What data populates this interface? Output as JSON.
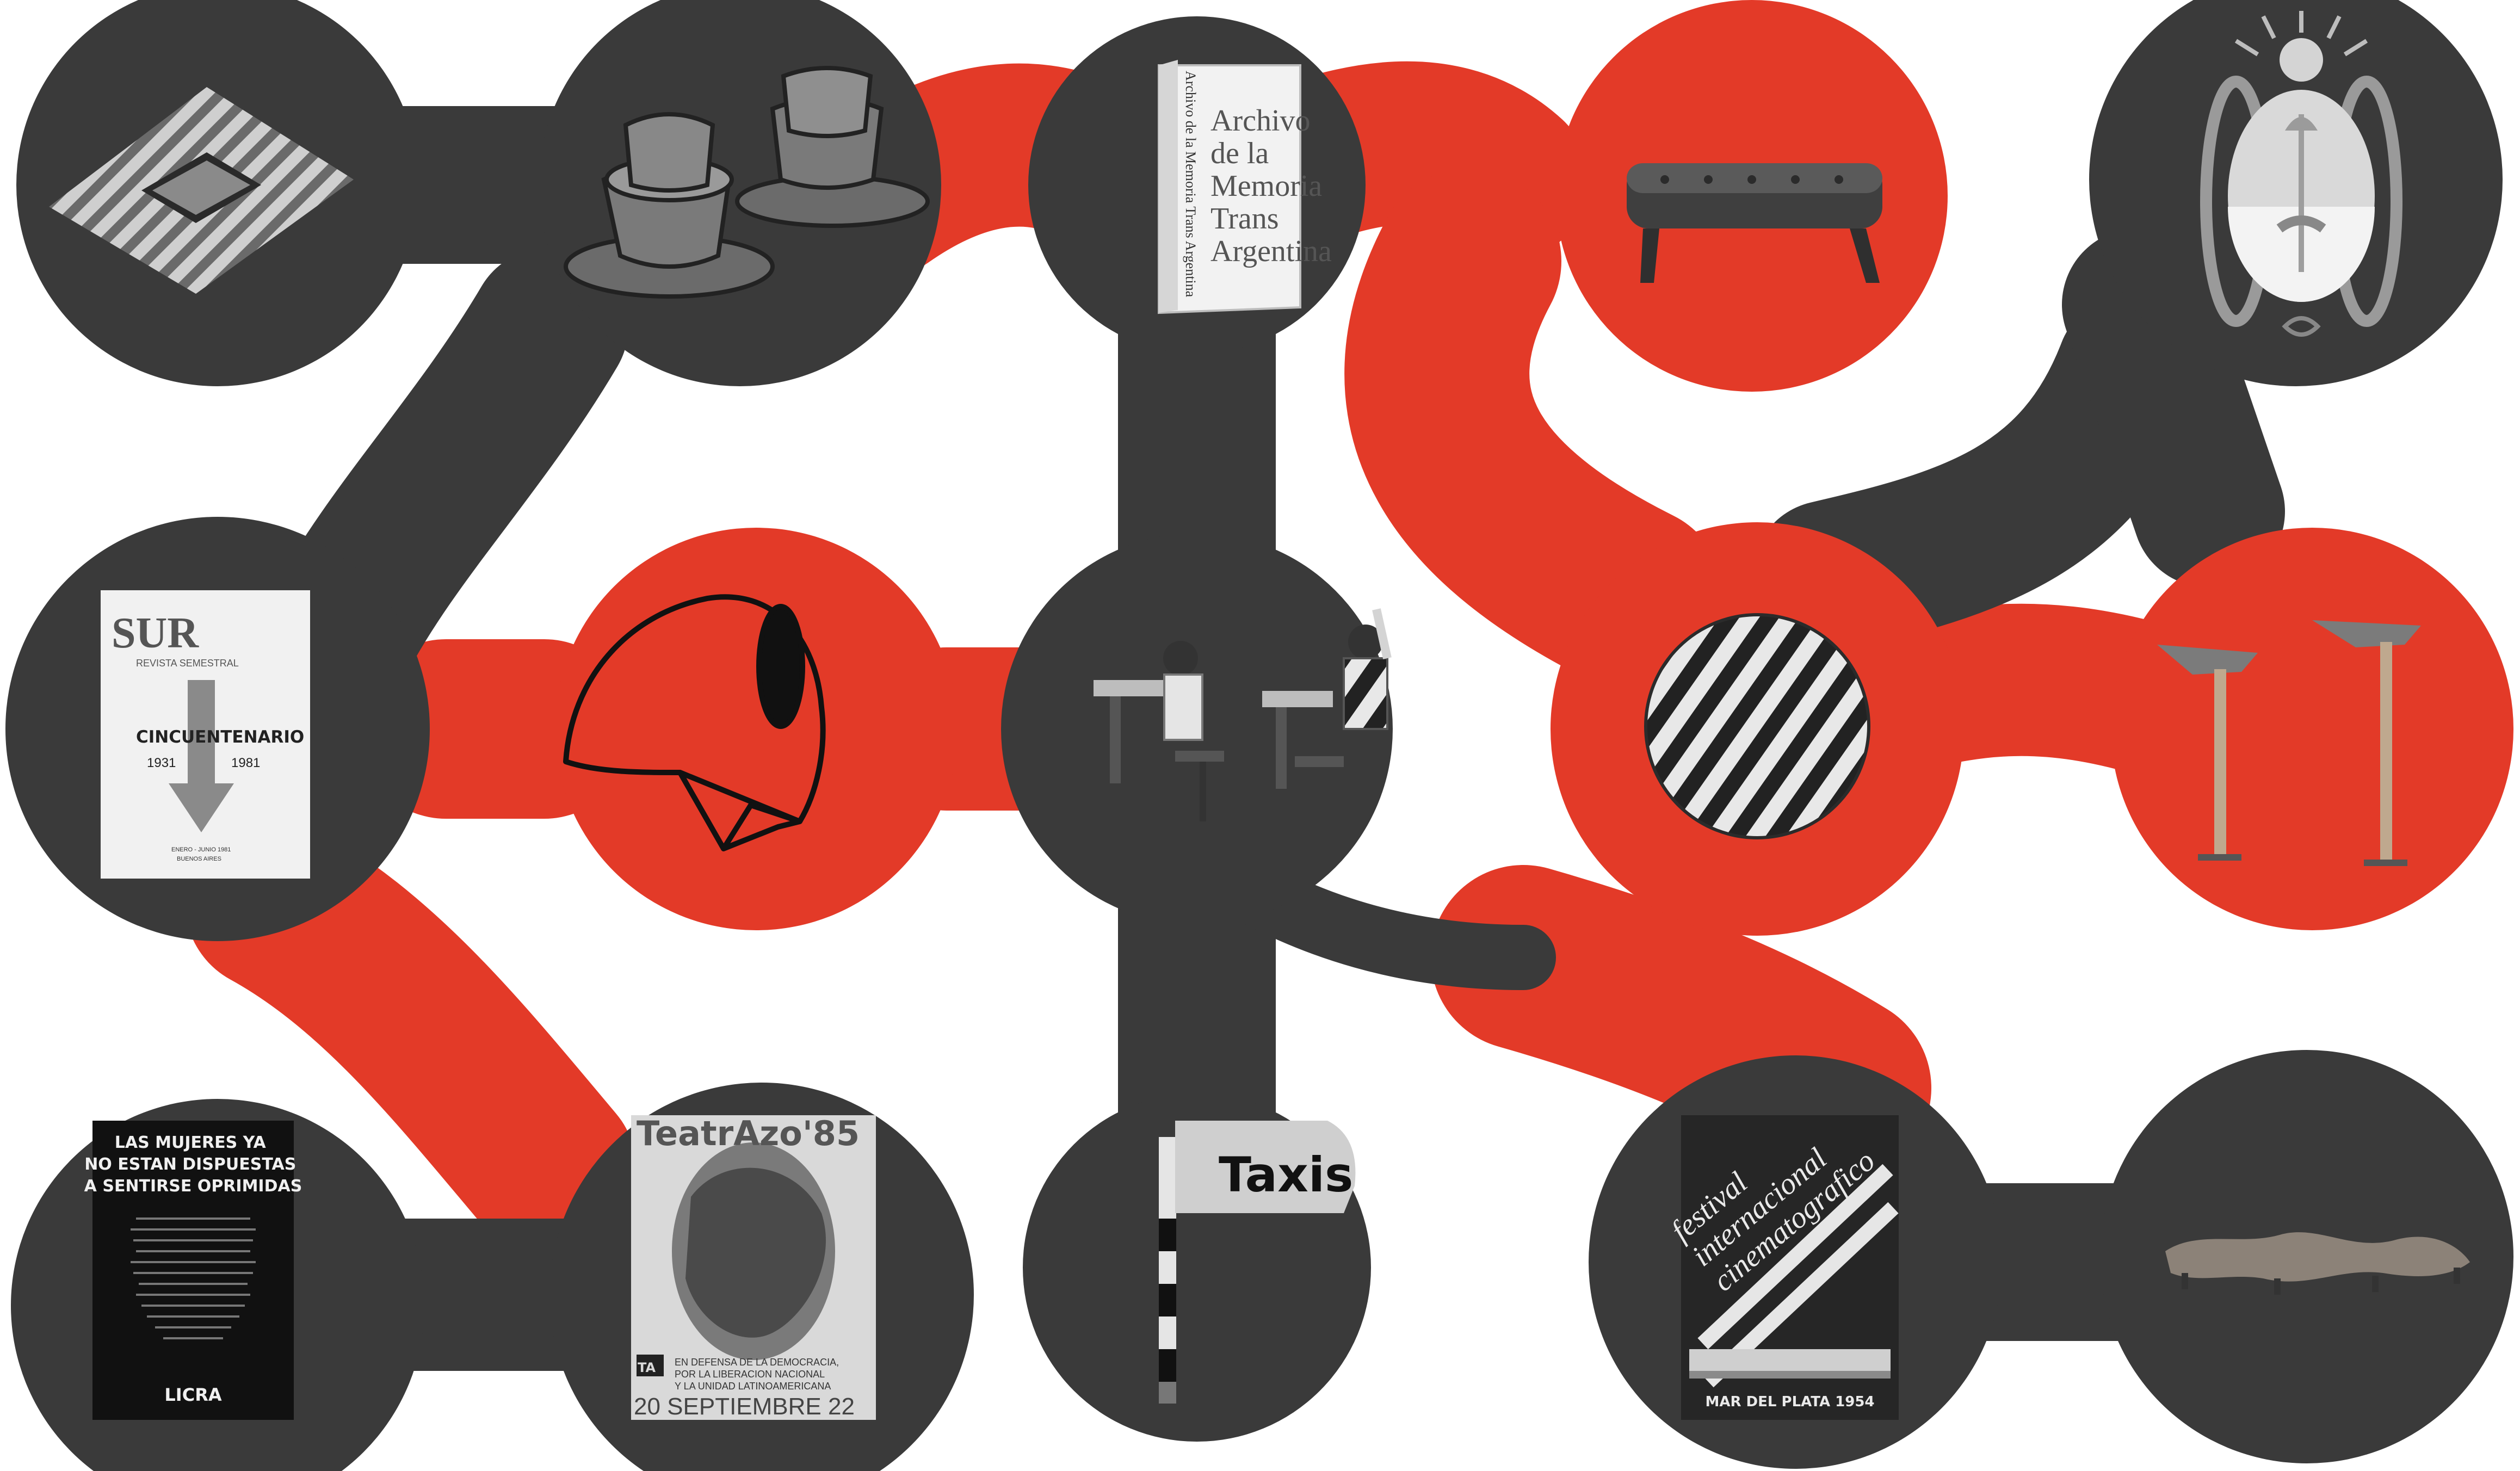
{
  "palette": {
    "red": "#E33A28",
    "dark": "#3A3A3A",
    "white": "#FFFFFF"
  },
  "book": {
    "spine": "Archivo de la Memoria Trans Argentina",
    "cover_lines": [
      "Archivo",
      "de la",
      "Memoria",
      "Trans",
      "Argentina"
    ]
  },
  "sur": {
    "title": "SUR",
    "subtitle": "REVISTA SEMESTRAL",
    "headline": "CINCUENTENARIO",
    "year_start": "1931",
    "year_end": "1981",
    "footer_1": "ENERO - JUNIO 1981",
    "footer_2": "BUENOS AIRES"
  },
  "licra": {
    "headline": [
      "LAS MUJERES YA",
      "NO ESTAN DISPUESTAS",
      "A SENTIRSE OPRIMIDAS"
    ],
    "brand": "LICRA"
  },
  "teatrazo": {
    "title": "TeatrAzo'85",
    "tagline_1": "EN DEFENSA DE LA DEMOCRACIA,",
    "tagline_2": "POR LA LIBERACION NACIONAL",
    "tagline_3": "Y LA UNIDAD LATINOAMERICANA",
    "date": "20 SEPTIEMBRE 22",
    "logo": "TA"
  },
  "taxi_sign": {
    "label": "Taxis"
  },
  "festival": {
    "lines": [
      "festival",
      "internacional",
      "cinematografico"
    ],
    "footer": "MAR DEL PLATA 1954"
  },
  "icons": [
    "ashtray-icon",
    "glass-cups-icon",
    "tufted-bench-icon",
    "argentine-coat-of-arms-icon",
    "white-headscarf-icon",
    "school-desks-icon",
    "striped-ball-icon",
    "stools-icon",
    "taxi-sign-icon",
    "bone-bench-icon"
  ]
}
